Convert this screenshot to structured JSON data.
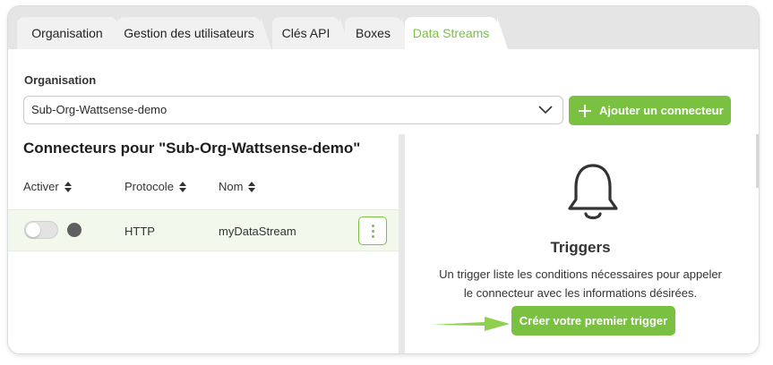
{
  "tabs": [
    {
      "label": "Organisation",
      "active": false
    },
    {
      "label": "Gestion des utilisateurs",
      "active": false
    },
    {
      "label": "Clés API",
      "active": false
    },
    {
      "label": "Boxes",
      "active": false
    },
    {
      "label": "Data Streams",
      "active": true
    }
  ],
  "organisation": {
    "label": "Organisation",
    "selected": "Sub-Org-Wattsense-demo",
    "add_connector_label": "Ajouter un connecteur"
  },
  "connectors": {
    "title": "Connecteurs pour \"Sub-Org-Wattsense-demo\"",
    "columns": [
      "Activer",
      "Protocole",
      "Nom"
    ],
    "rows": [
      {
        "enabled": false,
        "protocol": "HTTP",
        "name": "myDataStream"
      }
    ]
  },
  "triggers": {
    "icon": "bell-icon",
    "title": "Triggers",
    "description_line1": "Un trigger liste les conditions nécessaires pour appeler",
    "description_line2": "le connecteur avec les informations désirées.",
    "create_button": "Créer votre premier trigger"
  },
  "colors": {
    "accent": "#7ac142",
    "tab_bar": "#e5e5e5",
    "row_highlight": "#f3f8ec"
  }
}
